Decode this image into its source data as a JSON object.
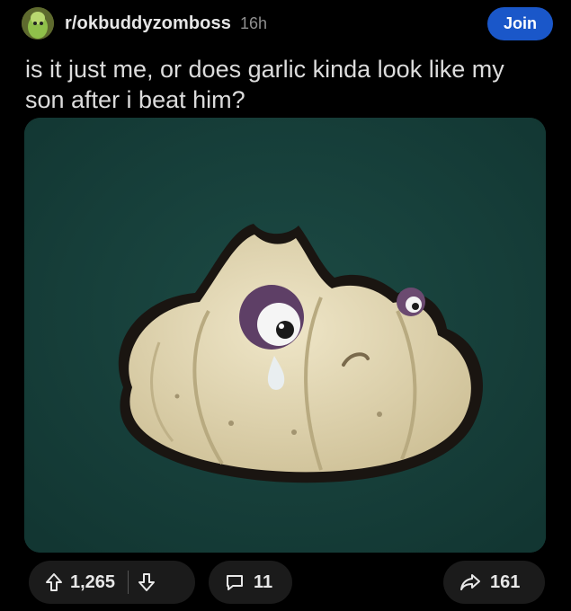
{
  "header": {
    "subreddit": "r/okbuddyzomboss",
    "age": "16h",
    "join_label": "Join"
  },
  "post": {
    "title": "is it just me, or does garlic kinda look like my son after i beat him?",
    "image_alt": "cartoon garlic bulb with a black eye and tear"
  },
  "actions": {
    "upvotes": "1,265",
    "comments": "11",
    "shares": "161"
  },
  "icons": {
    "upvote": "arrow-up-icon",
    "downvote": "arrow-down-icon",
    "comment": "comment-bubble-icon",
    "share": "share-arrow-icon"
  },
  "colors": {
    "background": "#000000",
    "join": "#1a57c9",
    "pill": "#1b1b1b",
    "image_bg": "#17403b"
  }
}
